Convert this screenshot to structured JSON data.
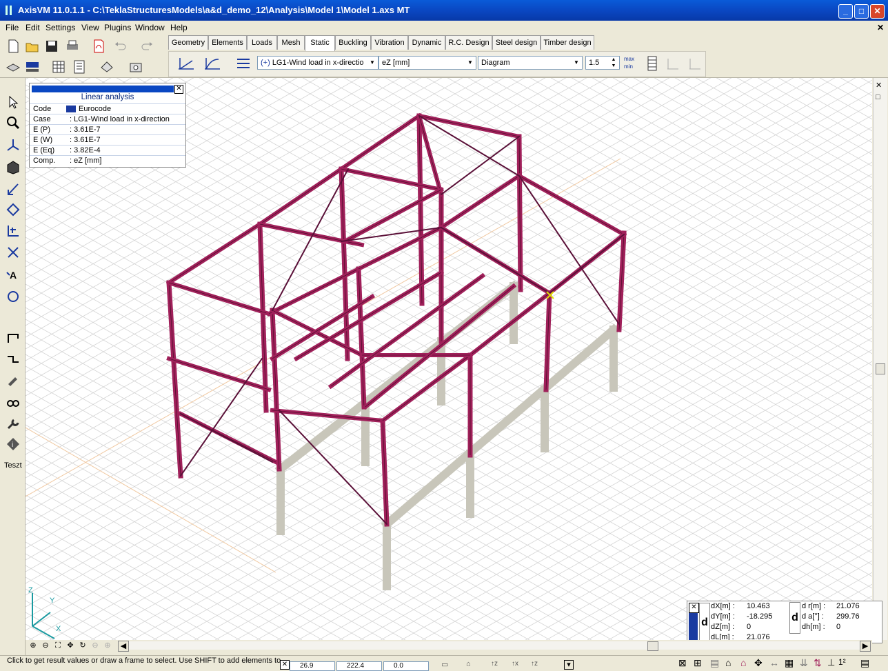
{
  "window": {
    "title": "AxisVM 11.0.1.1 - C:\\TeklaStructuresModels\\a&d_demo_12\\Analysis\\Model 1\\Model 1.axs MT"
  },
  "menu": [
    "File",
    "Edit",
    "Settings",
    "View",
    "Plugins",
    "Window",
    "Help"
  ],
  "tabs": [
    "Geometry",
    "Elements",
    "Loads",
    "Mesh",
    "Static",
    "Buckling",
    "Vibration",
    "Dynamic",
    "R.C. Design",
    "Steel design",
    "Timber design"
  ],
  "active_tab": "Static",
  "controls": {
    "load_case": "LG1-Wind load in x-directio",
    "component": "eZ [mm]",
    "display_mode": "Diagram",
    "scale": "1.5",
    "max_label": "max",
    "min_label": "min"
  },
  "left_toolbar": {
    "teszt_label": "Teszt"
  },
  "info_panel": {
    "title": "Linear analysis",
    "rows": [
      {
        "key": "Code",
        "value": "Eurocode"
      },
      {
        "key": "Case",
        "value": ": LG1-Wind load in x-direction"
      },
      {
        "key": "E (P)",
        "value": ": 3.61E-7"
      },
      {
        "key": "E (W)",
        "value": ": 3.61E-7"
      },
      {
        "key": "E (Eq)",
        "value": ": 3.82E-4"
      },
      {
        "key": "Comp.",
        "value": ": eZ [mm]"
      }
    ]
  },
  "axes": {
    "z": "Z",
    "y": "Y",
    "x": "X"
  },
  "coordinates": {
    "left_rows": [
      {
        "label": "dX[m]",
        "value": "10.463"
      },
      {
        "label": "dY[m]",
        "value": "-18.295"
      },
      {
        "label": "dZ[m]",
        "value": "0"
      },
      {
        "label": "dL[m]",
        "value": "21.076"
      }
    ],
    "right_rows": [
      {
        "label": "d r[m]",
        "value": "21.076"
      },
      {
        "label": "d a[°]",
        "value": "299.76"
      },
      {
        "label": "dh[m]",
        "value": "0"
      }
    ],
    "d_label": "d"
  },
  "status": {
    "message": "Click to get result values or draw a frame to select. Use SHIFT to add elements to",
    "x_value": "26.9",
    "y_value": "222.4",
    "z_value": "0.0"
  },
  "colors": {
    "steel_member": "#A0205A",
    "concrete_member": "#C8C6BA",
    "grid": "#D5D5D5",
    "title_bar": "#0A47C2"
  }
}
